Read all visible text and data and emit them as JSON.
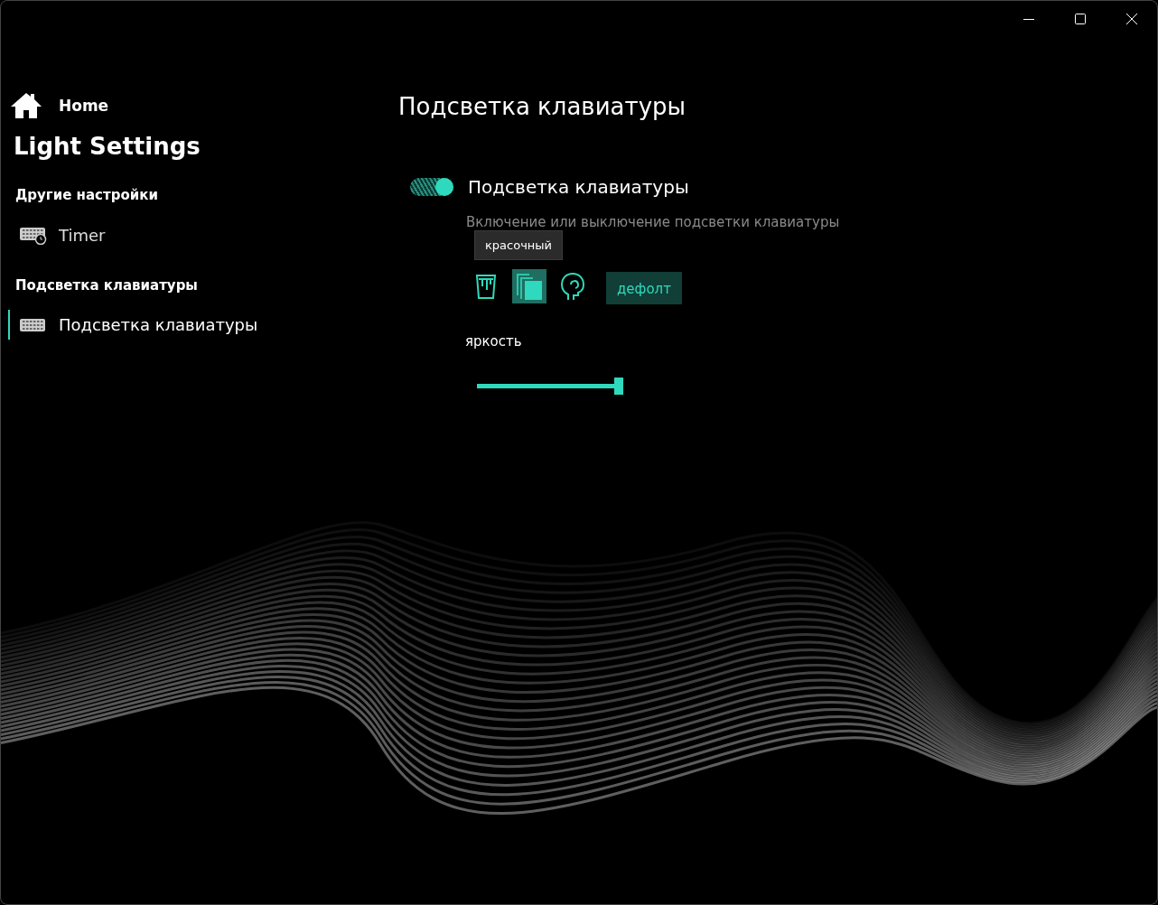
{
  "sidebar": {
    "home": {
      "label": "Home"
    },
    "title": "Light Settings",
    "groups": [
      {
        "header": "Другие настройки",
        "items": [
          {
            "label": "Timer",
            "kind": "timer",
            "selected": false
          }
        ]
      },
      {
        "header": "Подсветка клавиатуры",
        "items": [
          {
            "label": "Подсветка клавиатуры",
            "kind": "keyboard",
            "selected": true
          }
        ]
      }
    ]
  },
  "page": {
    "title": "Подсветка клавиатуры",
    "toggle": {
      "label": "Подсветка клавиатуры",
      "on": true,
      "description": "Включение или выключение подсветки клавиатуры"
    },
    "tooltip": "красочный",
    "modes": [
      {
        "kind": "paint",
        "selected": false
      },
      {
        "kind": "layers",
        "selected": true
      },
      {
        "kind": "head",
        "selected": false
      }
    ],
    "default_button": "дефолт",
    "brightness": {
      "label": "яркость",
      "level": 1
    }
  }
}
